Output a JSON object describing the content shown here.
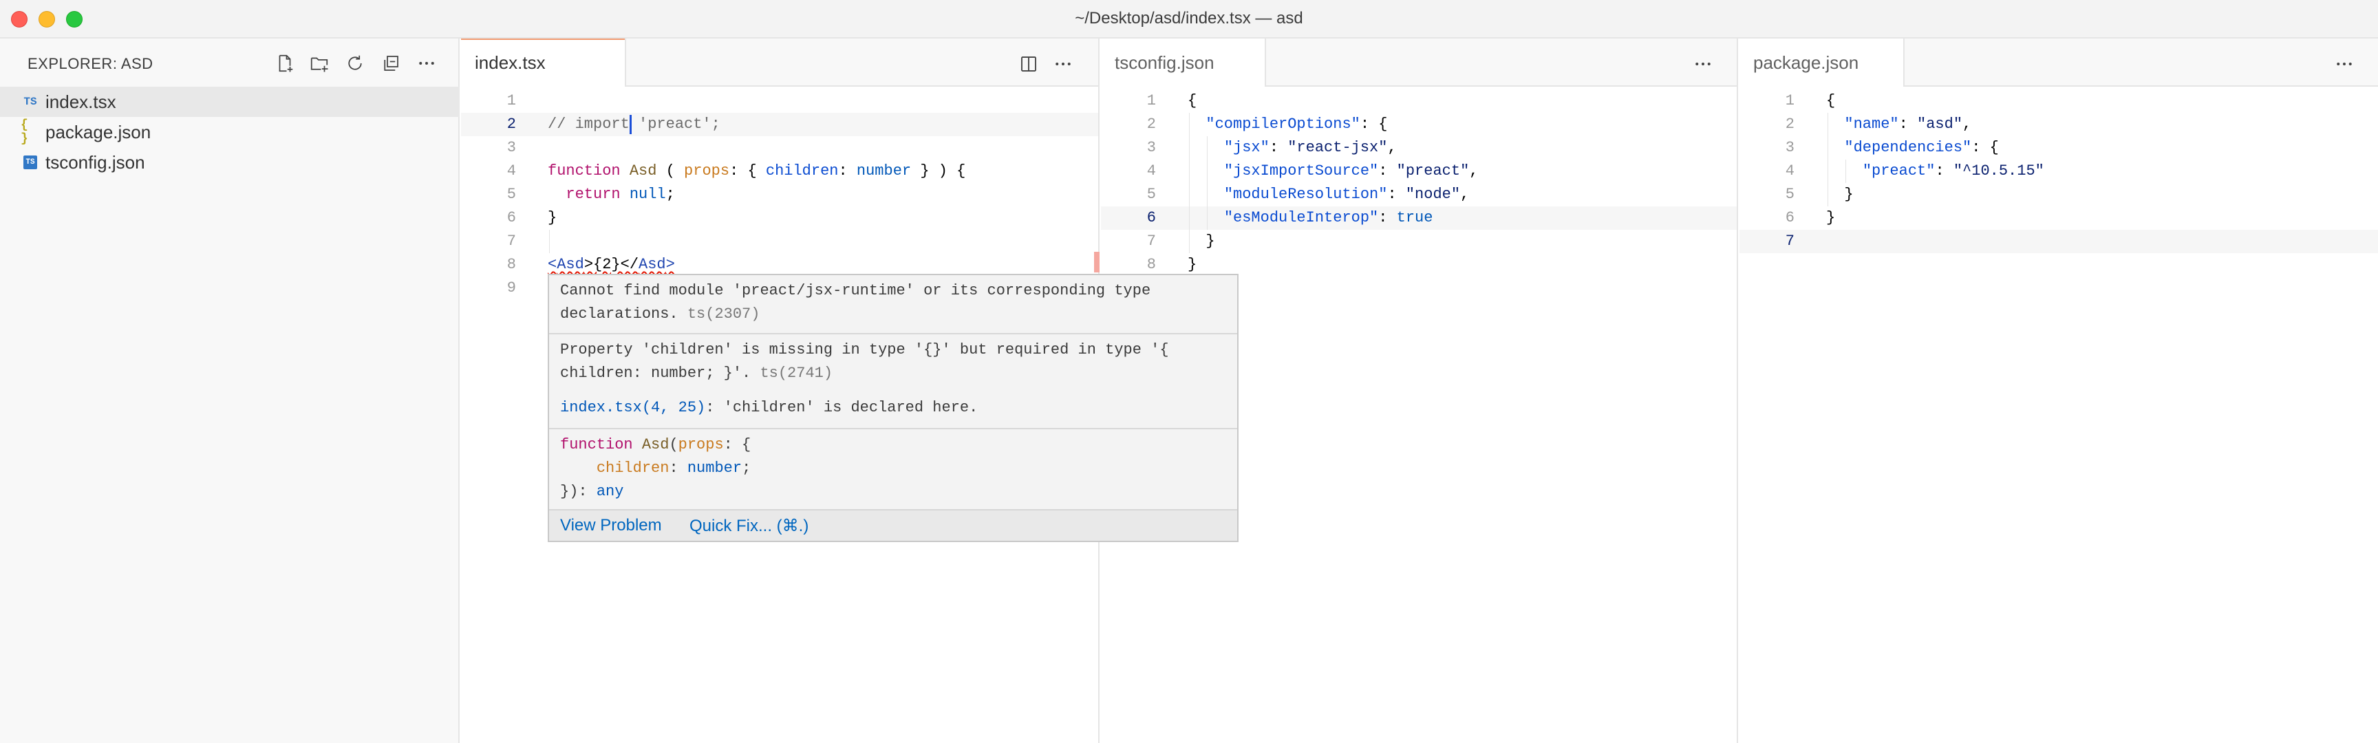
{
  "window": {
    "title": "~/Desktop/asd/index.tsx — asd"
  },
  "colors": {
    "accent": "#f19970",
    "error": "#e51400",
    "link": "#0057b8"
  },
  "sidebar": {
    "title": "EXPLORER: ASD",
    "actions": [
      "new-file-icon",
      "new-folder-icon",
      "refresh-icon",
      "collapse-all-icon",
      "more-icon"
    ],
    "files": [
      {
        "label": "index.tsx",
        "icon_text": "TS",
        "icon_color": "#3178c6",
        "active": true
      },
      {
        "label": "package.json",
        "icon_text": "{ }",
        "icon_color": "#cbcb41",
        "active": false
      },
      {
        "label": "tsconfig.json",
        "icon_text": "TS",
        "icon_color": "#3178c6",
        "active": false
      }
    ]
  },
  "editor1": {
    "tab_label": "index.tsx",
    "line_numbers": [
      "1",
      "2",
      "3",
      "4",
      "5",
      "6",
      "7",
      "8",
      "9"
    ],
    "current_line": "2"
  },
  "editor2": {
    "tab_label": "tsconfig.json",
    "line_numbers": [
      "1",
      "2",
      "3",
      "4",
      "5",
      "6",
      "7",
      "8"
    ],
    "current_line": "6"
  },
  "editor3": {
    "tab_label": "package.json",
    "line_numbers": [
      "1",
      "2",
      "3",
      "4",
      "5",
      "6",
      "7"
    ],
    "current_line": "7"
  },
  "hover": {
    "error1_text": "Cannot find module 'preact/jsx-runtime' or its corresponding type",
    "error1_text2": "declarations.",
    "error1_code": "ts(2307)",
    "error2_text": "Property 'children' is missing in type '{}' but required in type '{",
    "error2_text2": "children: number; }'.",
    "error2_code": "ts(2741)",
    "related_link": "index.tsx(4, 25)",
    "related_text": ": 'children' is declared here.",
    "view_problem": "View Problem",
    "quick_fix": "Quick Fix... (⌘.)"
  }
}
